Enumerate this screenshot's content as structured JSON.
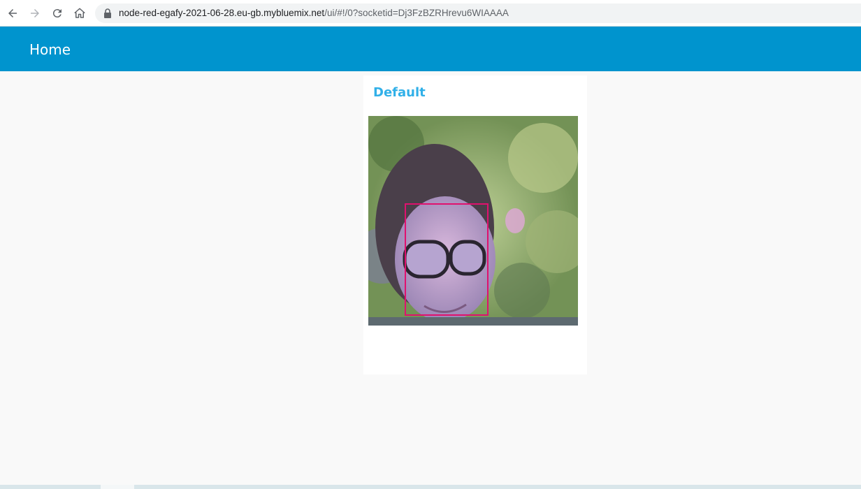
{
  "browser": {
    "url_host": "node-red-egafy-2021-06-28.eu-gb.mybluemix.net",
    "url_path": "/ui/#!/0?socketid=Dj3FzBZRHrevu6WIAAAA"
  },
  "header": {
    "title": "Home"
  },
  "card": {
    "title": "Default",
    "image": {
      "description_icon": "webcam-photo",
      "annotation": "face-detection-box",
      "box_color": "#e0116e"
    }
  },
  "colors": {
    "header_bg": "#0094ce",
    "card_title": "#31b0e8",
    "page_bg": "#f9f9f9"
  }
}
